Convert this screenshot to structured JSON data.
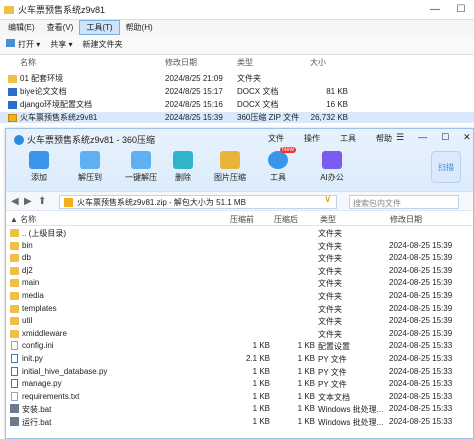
{
  "explorer": {
    "title": "火车票预售系统z9v81",
    "menu": [
      "编辑(E)",
      "查看(V)",
      "工具(T)",
      "帮助(H)"
    ],
    "toolbar": [
      "打开",
      "共享",
      "新建文件夹"
    ],
    "columns": [
      "名称",
      "修改日期",
      "类型",
      "大小"
    ],
    "rows": [
      {
        "name": "01 配套环境",
        "date": "2024/8/25 21:09",
        "type": "文件夹",
        "size": ""
      },
      {
        "name": "biye论文文档",
        "date": "2024/8/25 15:17",
        "type": "DOCX 文档",
        "size": "81 KB"
      },
      {
        "name": "django环境配置文档",
        "date": "2024/8/25 15:16",
        "type": "DOCX 文档",
        "size": "16 KB"
      },
      {
        "name": "火车票预售系统z9v81",
        "date": "2024/8/25 15:39",
        "type": "360压缩 ZIP 文件",
        "size": "26,732 KB"
      }
    ]
  },
  "zip": {
    "title": "火车票预售系统z9v81 - 360压缩",
    "menu": [
      "文件",
      "操作",
      "工具",
      "帮助"
    ],
    "tools": [
      "添加",
      "解压到",
      "一键解压",
      "删除",
      "图片压缩",
      "工具",
      "AI办公"
    ],
    "new_badge": "New",
    "scan": "扫描",
    "address": "火车票预售系统z9v81.zip - 解包大小为 51.1 MB",
    "search_placeholder": "搜索包内文件",
    "columns": [
      "名称",
      "压缩前",
      "压缩后",
      "类型",
      "修改日期"
    ],
    "rows": [
      {
        "name": ".. (上级目录)",
        "before": "",
        "after": "",
        "type": "文件夹",
        "date": "",
        "kind": "folder"
      },
      {
        "name": "bin",
        "before": "",
        "after": "",
        "type": "文件夹",
        "date": "2024-08-25 15:39",
        "kind": "folder"
      },
      {
        "name": "db",
        "before": "",
        "after": "",
        "type": "文件夹",
        "date": "2024-08-25 15:39",
        "kind": "folder"
      },
      {
        "name": "dj2",
        "before": "",
        "after": "",
        "type": "文件夹",
        "date": "2024-08-25 15:39",
        "kind": "folder"
      },
      {
        "name": "main",
        "before": "",
        "after": "",
        "type": "文件夹",
        "date": "2024-08-25 15:39",
        "kind": "folder"
      },
      {
        "name": "media",
        "before": "",
        "after": "",
        "type": "文件夹",
        "date": "2024-08-25 15:39",
        "kind": "folder"
      },
      {
        "name": "templates",
        "before": "",
        "after": "",
        "type": "文件夹",
        "date": "2024-08-25 15:39",
        "kind": "folder"
      },
      {
        "name": "util",
        "before": "",
        "after": "",
        "type": "文件夹",
        "date": "2024-08-25 15:39",
        "kind": "folder"
      },
      {
        "name": "xmiddleware",
        "before": "",
        "after": "",
        "type": "文件夹",
        "date": "2024-08-25 15:39",
        "kind": "folder"
      },
      {
        "name": "config.ini",
        "before": "1 KB",
        "after": "1 KB",
        "type": "配置设置",
        "date": "2024-08-25 15:33",
        "kind": "file"
      },
      {
        "name": "init.py",
        "before": "2.1 KB",
        "after": "1 KB",
        "type": "PY 文件",
        "date": "2024-08-25 15:33",
        "kind": "py"
      },
      {
        "name": "initial_hive_database.py",
        "before": "1 KB",
        "after": "1 KB",
        "type": "PY 文件",
        "date": "2024-08-25 15:33",
        "kind": "py"
      },
      {
        "name": "manage.py",
        "before": "1 KB",
        "after": "1 KB",
        "type": "PY 文件",
        "date": "2024-08-25 15:33",
        "kind": "py"
      },
      {
        "name": "requirements.txt",
        "before": "1 KB",
        "after": "1 KB",
        "type": "文本文档",
        "date": "2024-08-25 15:33",
        "kind": "file"
      },
      {
        "name": "安装.bat",
        "before": "1 KB",
        "after": "1 KB",
        "type": "Windows 批处理...",
        "date": "2024-08-25 15:33",
        "kind": "bat"
      },
      {
        "name": "运行.bat",
        "before": "1 KB",
        "after": "1 KB",
        "type": "Windows 批处理...",
        "date": "2024-08-25 15:33",
        "kind": "bat"
      }
    ]
  }
}
